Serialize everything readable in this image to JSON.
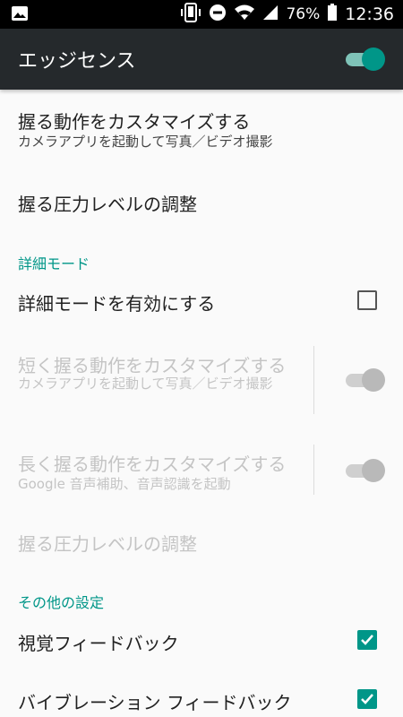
{
  "status_bar": {
    "battery": "76%",
    "time": "12:36",
    "icons": [
      "image-icon",
      "phone-vibrate-icon",
      "do-not-disturb-icon",
      "wifi-icon",
      "signal-icon",
      "battery-icon"
    ]
  },
  "app_bar": {
    "title": "エッジセンス",
    "master_switch_on": true,
    "accent": "#009688"
  },
  "items": {
    "customize_squeeze": {
      "title": "握る動作をカスタマイズする",
      "summary": "カメラアプリを起動して写真／ビデオ撮影"
    },
    "adjust_pressure": {
      "title": "握る圧力レベルの調整"
    }
  },
  "advanced_section": {
    "header": "詳細モード",
    "enable_advanced": {
      "title": "詳細モードを有効にする",
      "checked": false
    },
    "short_squeeze": {
      "title": "短く握る動作をカスタマイズする",
      "summary": "カメラアプリを起動して写真／ビデオ撮影",
      "enabled": false
    },
    "long_squeeze": {
      "title": "長く握る動作をカスタマイズする",
      "summary": "Google 音声補助、音声認識を起動",
      "enabled": false
    },
    "adjust_pressure_advanced": {
      "title": "握る圧力レベルの調整",
      "enabled": false
    }
  },
  "other_section": {
    "header": "その他の設定",
    "visual_feedback": {
      "title": "視覚フィードバック",
      "checked": true
    },
    "vibration_feedback": {
      "title": "バイブレーション フィードバック",
      "checked": true
    }
  }
}
